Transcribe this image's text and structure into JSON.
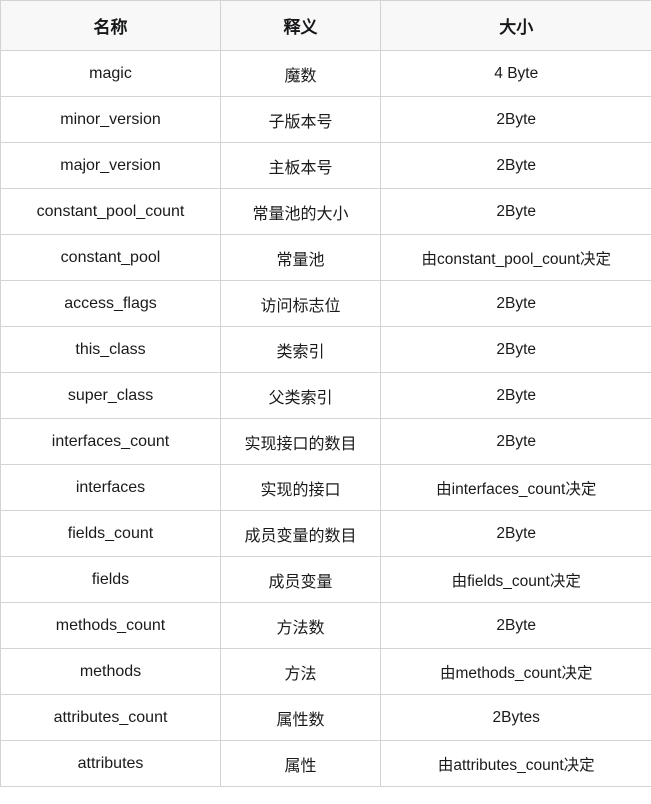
{
  "table": {
    "headers": [
      "名称",
      "释义",
      "大小"
    ],
    "rows": [
      {
        "name": "magic",
        "meaning": "魔数",
        "size": "4 Byte"
      },
      {
        "name": "minor_version",
        "meaning": "子版本号",
        "size": "2Byte"
      },
      {
        "name": "major_version",
        "meaning": "主板本号",
        "size": "2Byte"
      },
      {
        "name": "constant_pool_count",
        "meaning": "常量池的大小",
        "size": "2Byte"
      },
      {
        "name": "constant_pool",
        "meaning": "常量池",
        "size": "由constant_pool_count决定"
      },
      {
        "name": "access_flags",
        "meaning": "访问标志位",
        "size": "2Byte"
      },
      {
        "name": "this_class",
        "meaning": "类索引",
        "size": "2Byte"
      },
      {
        "name": "super_class",
        "meaning": "父类索引",
        "size": "2Byte"
      },
      {
        "name": "interfaces_count",
        "meaning": "实现接口的数目",
        "size": "2Byte"
      },
      {
        "name": "interfaces",
        "meaning": "实现的接口",
        "size": "由interfaces_count决定"
      },
      {
        "name": "fields_count",
        "meaning": "成员变量的数目",
        "size": "2Byte"
      },
      {
        "name": "fields",
        "meaning": "成员变量",
        "size": "由fields_count决定"
      },
      {
        "name": "methods_count",
        "meaning": "方法数",
        "size": "2Byte"
      },
      {
        "name": "methods",
        "meaning": "方法",
        "size": "由methods_count决定"
      },
      {
        "name": "attributes_count",
        "meaning": "属性数",
        "size": "2Bytes"
      },
      {
        "name": "attributes",
        "meaning": "属性",
        "size": "由attributes_count决定"
      }
    ]
  },
  "colors": {
    "header_background": "#f8f8f8",
    "body_background": "#ffffff",
    "border": "#d3d3d3",
    "header_text": "#16181a",
    "body_text": "#1a1a1a"
  }
}
